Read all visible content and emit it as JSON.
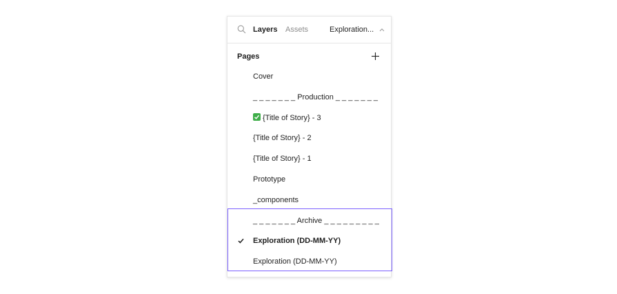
{
  "header": {
    "tabs": [
      {
        "label": "Layers"
      },
      {
        "label": "Assets"
      }
    ],
    "current_page_label": "Exploration..."
  },
  "pages": {
    "title": "Pages",
    "items": [
      {
        "label": "Cover"
      },
      {
        "label": "_ _ _ _ _ _ _ Production _ _ _ _ _ _ _"
      },
      {
        "label": "{Title of Story} - 3",
        "emoji": "white-check-mark-emoji"
      },
      {
        "label": "{Title of Story} - 2"
      },
      {
        "label": "{Title of Story} - 1"
      },
      {
        "label": "Prototype"
      },
      {
        "label": "_components"
      },
      {
        "label": "_ _ _ _ _ _ _ Archive _ _ _ _ _ _ _ _ _"
      },
      {
        "label": "Exploration (DD-MM-YY)",
        "selected": true
      },
      {
        "label": "Exploration (DD-MM-YY)"
      }
    ]
  },
  "colors": {
    "highlight": "#7b61ff",
    "emoji_check": "#3fae49"
  }
}
